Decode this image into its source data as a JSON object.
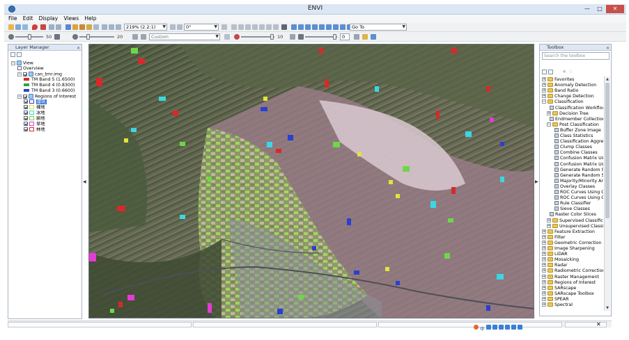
{
  "window": {
    "title": "ENVI",
    "minimize": "—",
    "maximize": "□",
    "close": "✕"
  },
  "menu": {
    "items": [
      "File",
      "Edit",
      "Display",
      "Views",
      "Help"
    ]
  },
  "toolbar": {
    "zoom": "219% (2.2:1)",
    "rotation": "0°",
    "goto": "Go To",
    "stretch": "Custom",
    "brightness": "50",
    "contrast": "20",
    "sharpen": "10",
    "transparency": "0"
  },
  "layer_manager": {
    "title": "Layer Manager",
    "rows": [
      {
        "label": "View",
        "level": 0,
        "twist": "−",
        "icon": "view-icon"
      },
      {
        "label": "Overview",
        "level": 1,
        "check": false
      },
      {
        "label": "can_tmr.img",
        "level": 1,
        "twist": "−",
        "check": true,
        "icon": "raster-icon"
      },
      {
        "label": "TM Band 5 (1.6500)",
        "level": 2,
        "swatch": "#d22d2d"
      },
      {
        "label": "TM Band 4 (0.8300)",
        "level": 2,
        "swatch": "#2fa33a"
      },
      {
        "label": "TM Band 3 (0.6600)",
        "level": 2,
        "swatch": "#2846c8"
      },
      {
        "label": "Regions of Interest",
        "level": 1,
        "twist": "−",
        "check": true,
        "icon": "roi-icon"
      },
      {
        "label": "建筑",
        "level": 2,
        "check": true,
        "selected": true,
        "roi_color": "#2a3fd0"
      },
      {
        "label": "裸地",
        "level": 2,
        "check": true,
        "roi_color": "#e6e23a"
      },
      {
        "label": "冰地",
        "level": 2,
        "check": true,
        "roi_color": "#3ad7e6"
      },
      {
        "label": "耕地",
        "level": 2,
        "check": true,
        "roi_color": "#6fd64a"
      },
      {
        "label": "草地",
        "level": 2,
        "check": true,
        "roi_color": "#e63ad7"
      },
      {
        "label": "林地",
        "level": 2,
        "check": true,
        "roi_color": "#d62a2a"
      }
    ]
  },
  "toolbox": {
    "title": "Toolbox",
    "search_placeholder": "Search the toolbox",
    "rows": [
      {
        "label": "Favorites",
        "level": 0,
        "twist": "+",
        "kind": "folder"
      },
      {
        "label": "Anomaly Detection",
        "level": 0,
        "twist": "+",
        "kind": "folder"
      },
      {
        "label": "Band Ratio",
        "level": 0,
        "twist": "+",
        "kind": "folder"
      },
      {
        "label": "Change Detection",
        "level": 0,
        "twist": "+",
        "kind": "folder"
      },
      {
        "label": "Classification",
        "level": 0,
        "twist": "−",
        "kind": "folder"
      },
      {
        "label": "Classification Workflow",
        "level": 1,
        "kind": "tool"
      },
      {
        "label": "Decision Tree",
        "level": 1,
        "twist": "+",
        "kind": "folder"
      },
      {
        "label": "Endmember Collection",
        "level": 1,
        "kind": "tool"
      },
      {
        "label": "Post Classification",
        "level": 1,
        "twist": "−",
        "kind": "folder"
      },
      {
        "label": "Buffer Zone Image",
        "level": 2,
        "kind": "tool"
      },
      {
        "label": "Class Statistics",
        "level": 2,
        "kind": "tool"
      },
      {
        "label": "Classification Aggregation",
        "level": 2,
        "kind": "tool"
      },
      {
        "label": "Clump Classes",
        "level": 2,
        "kind": "tool"
      },
      {
        "label": "Combine Classes",
        "level": 2,
        "kind": "tool"
      },
      {
        "label": "Confusion Matrix Using Ground Truth Image",
        "level": 2,
        "kind": "tool"
      },
      {
        "label": "Confusion Matrix Using Ground Truth ROIs",
        "level": 2,
        "kind": "tool"
      },
      {
        "label": "Generate Random Sample Using Ground Truth Image",
        "level": 2,
        "kind": "tool"
      },
      {
        "label": "Generate Random Sample Using Ground Truth ROIs",
        "level": 2,
        "kind": "tool"
      },
      {
        "label": "Majority/Minority Analysis",
        "level": 2,
        "kind": "tool"
      },
      {
        "label": "Overlay Classes",
        "level": 2,
        "kind": "tool"
      },
      {
        "label": "ROC Curves Using Ground Truth Image",
        "level": 2,
        "kind": "tool"
      },
      {
        "label": "ROC Curves Using Ground Truth ROIs",
        "level": 2,
        "kind": "tool"
      },
      {
        "label": "Rule Classifier",
        "level": 2,
        "kind": "tool"
      },
      {
        "label": "Sieve Classes",
        "level": 2,
        "kind": "tool"
      },
      {
        "label": "Raster Color Slices",
        "level": 1,
        "kind": "tool"
      },
      {
        "label": "Supervised Classification",
        "level": 1,
        "twist": "+",
        "kind": "folder"
      },
      {
        "label": "Unsupervised Classification",
        "level": 1,
        "twist": "+",
        "kind": "folder"
      },
      {
        "label": "Feature Extraction",
        "level": 0,
        "twist": "+",
        "kind": "folder"
      },
      {
        "label": "Filter",
        "level": 0,
        "twist": "+",
        "kind": "folder"
      },
      {
        "label": "Geometric Correction",
        "level": 0,
        "twist": "+",
        "kind": "folder"
      },
      {
        "label": "Image Sharpening",
        "level": 0,
        "twist": "+",
        "kind": "folder"
      },
      {
        "label": "LiDAR",
        "level": 0,
        "twist": "+",
        "kind": "folder"
      },
      {
        "label": "Mosaicking",
        "level": 0,
        "twist": "+",
        "kind": "folder"
      },
      {
        "label": "Radar",
        "level": 0,
        "twist": "+",
        "kind": "folder"
      },
      {
        "label": "Radiometric Correction",
        "level": 0,
        "twist": "+",
        "kind": "folder"
      },
      {
        "label": "Raster Management",
        "level": 0,
        "twist": "+",
        "kind": "folder"
      },
      {
        "label": "Regions of Interest",
        "level": 0,
        "twist": "+",
        "kind": "folder"
      },
      {
        "label": "SARscape",
        "level": 0,
        "twist": "+",
        "kind": "folder"
      },
      {
        "label": "SARscape Toolbox",
        "level": 0,
        "twist": "+",
        "kind": "folder"
      },
      {
        "label": "SPEAR",
        "level": 0,
        "twist": "+",
        "kind": "folder"
      },
      {
        "label": "Spectral",
        "level": 0,
        "twist": "+",
        "kind": "folder"
      }
    ]
  },
  "statusbar": {
    "ime_label": "中"
  },
  "colors": {
    "accent": "#3375d6",
    "titlebar": "#dce6f4"
  }
}
